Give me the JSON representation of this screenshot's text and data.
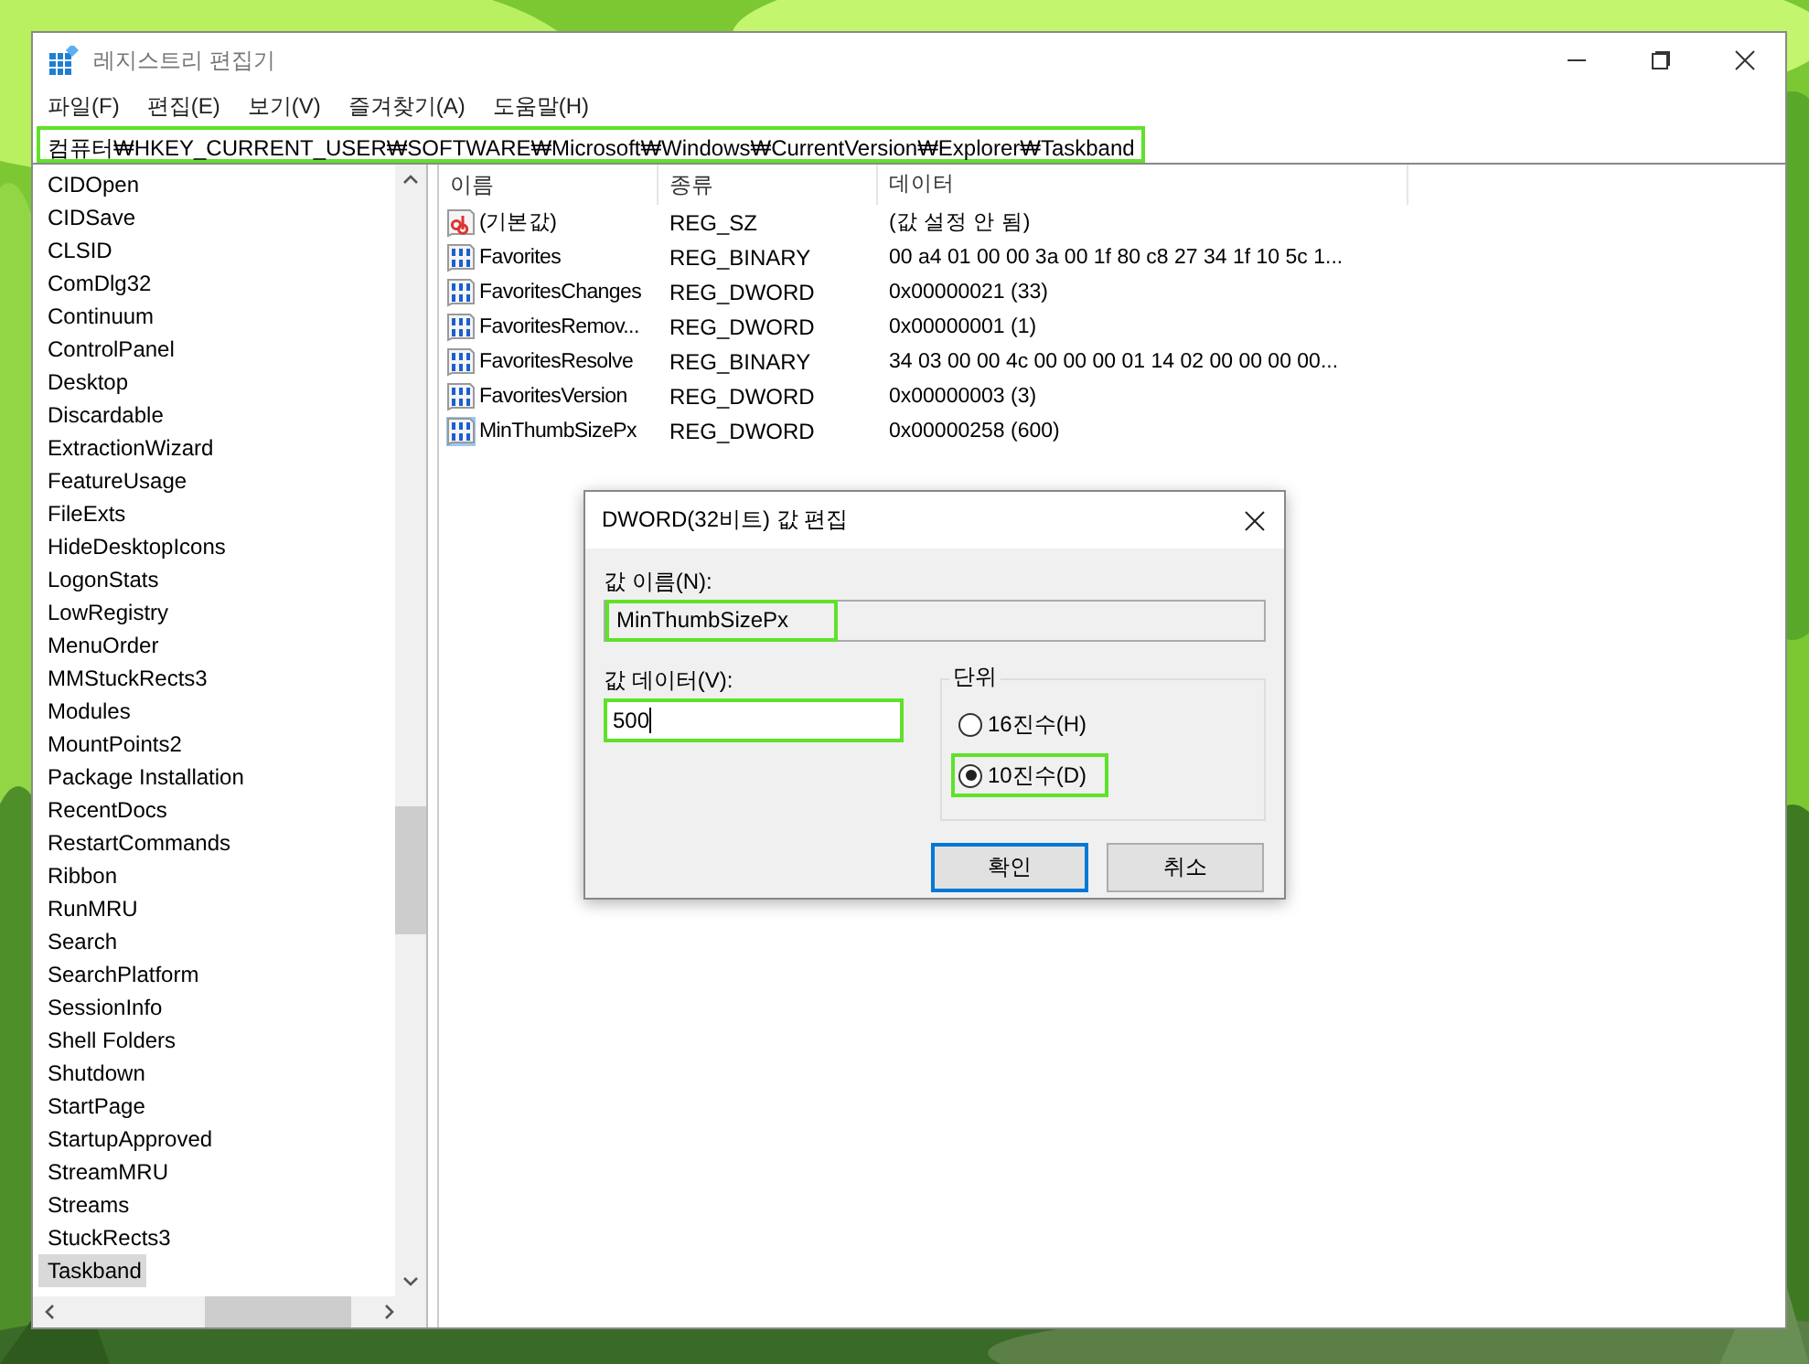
{
  "window": {
    "title": "레지스트리 편집기"
  },
  "menu": [
    "파일(F)",
    "편집(E)",
    "보기(V)",
    "즐겨찾기(A)",
    "도움말(H)"
  ],
  "address": {
    "value": "컴퓨터₩HKEY_CURRENT_USER₩SOFTWARE₩Microsoft₩Windows₩CurrentVersion₩Explorer₩Taskband",
    "highlighted": true
  },
  "tree": {
    "items": [
      {
        "label": "CIDOpen",
        "selected": false
      },
      {
        "label": "CIDSave",
        "selected": false
      },
      {
        "label": "CLSID",
        "selected": false
      },
      {
        "label": "ComDlg32",
        "selected": false
      },
      {
        "label": "Continuum",
        "selected": false
      },
      {
        "label": "ControlPanel",
        "selected": false
      },
      {
        "label": "Desktop",
        "selected": false
      },
      {
        "label": "Discardable",
        "selected": false
      },
      {
        "label": "ExtractionWizard",
        "selected": false
      },
      {
        "label": "FeatureUsage",
        "selected": false
      },
      {
        "label": "FileExts",
        "selected": false
      },
      {
        "label": "HideDesktopIcons",
        "selected": false
      },
      {
        "label": "LogonStats",
        "selected": false
      },
      {
        "label": "LowRegistry",
        "selected": false
      },
      {
        "label": "MenuOrder",
        "selected": false
      },
      {
        "label": "MMStuckRects3",
        "selected": false
      },
      {
        "label": "Modules",
        "selected": false
      },
      {
        "label": "MountPoints2",
        "selected": false
      },
      {
        "label": "Package Installation",
        "selected": false
      },
      {
        "label": "RecentDocs",
        "selected": false
      },
      {
        "label": "RestartCommands",
        "selected": false
      },
      {
        "label": "Ribbon",
        "selected": false
      },
      {
        "label": "RunMRU",
        "selected": false
      },
      {
        "label": "Search",
        "selected": false
      },
      {
        "label": "SearchPlatform",
        "selected": false
      },
      {
        "label": "SessionInfo",
        "selected": false
      },
      {
        "label": "Shell Folders",
        "selected": false
      },
      {
        "label": "Shutdown",
        "selected": false
      },
      {
        "label": "StartPage",
        "selected": false
      },
      {
        "label": "StartupApproved",
        "selected": false
      },
      {
        "label": "StreamMRU",
        "selected": false
      },
      {
        "label": "Streams",
        "selected": false
      },
      {
        "label": "StuckRects3",
        "selected": false
      },
      {
        "label": "Taskband",
        "selected": true
      }
    ]
  },
  "values": {
    "columns": [
      "이름",
      "종류",
      "데이터"
    ],
    "rows": [
      {
        "kind": "string",
        "name": "(기본값)",
        "type": "REG_SZ",
        "data": "(값 설정 안 됨)",
        "selected": false
      },
      {
        "kind": "binary",
        "name": "Favorites",
        "type": "REG_BINARY",
        "data": "00 a4 01 00 00 3a 00 1f 80 c8 27 34 1f 10 5c 1...",
        "selected": false
      },
      {
        "kind": "binary",
        "name": "FavoritesChanges",
        "type": "REG_DWORD",
        "data": "0x00000021 (33)",
        "selected": false
      },
      {
        "kind": "binary",
        "name": "FavoritesRemov...",
        "type": "REG_DWORD",
        "data": "0x00000001 (1)",
        "selected": false
      },
      {
        "kind": "binary",
        "name": "FavoritesResolve",
        "type": "REG_BINARY",
        "data": "34 03 00 00 4c 00 00 00 01 14 02 00 00 00 00...",
        "selected": false
      },
      {
        "kind": "binary",
        "name": "FavoritesVersion",
        "type": "REG_DWORD",
        "data": "0x00000003 (3)",
        "selected": false
      },
      {
        "kind": "binary",
        "name": "MinThumbSizePx",
        "type": "REG_DWORD",
        "data": "0x00000258 (600)",
        "selected": true
      }
    ]
  },
  "dialog": {
    "title": "DWORD(32비트) 값 편집",
    "name_label": "값 이름(N):",
    "name_value": "MinThumbSizePx",
    "name_highlighted": true,
    "data_label": "값 데이터(V):",
    "data_value": "500",
    "data_highlighted": true,
    "base_group": "단위",
    "base_options": [
      {
        "label": "16진수(H)",
        "selected": false,
        "highlighted": false
      },
      {
        "label": "10진수(D)",
        "selected": true,
        "highlighted": true
      }
    ],
    "buttons": [
      {
        "label": "확인",
        "default": true
      },
      {
        "label": "취소",
        "default": false
      }
    ]
  }
}
